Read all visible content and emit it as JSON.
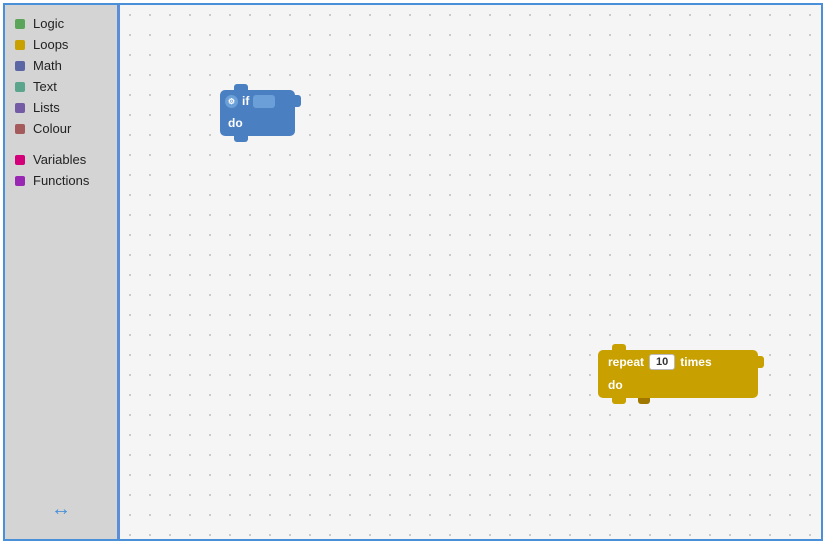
{
  "sidebar": {
    "items": [
      {
        "id": "logic",
        "label": "Logic",
        "color": "#5ba55b"
      },
      {
        "id": "loops",
        "label": "Loops",
        "color": "#c8a000"
      },
      {
        "id": "math",
        "label": "Math",
        "color": "#5b67a5"
      },
      {
        "id": "text",
        "label": "Text",
        "color": "#5ba58c"
      },
      {
        "id": "lists",
        "label": "Lists",
        "color": "#745ba5"
      },
      {
        "id": "colour",
        "label": "Colour",
        "color": "#a55b5b"
      }
    ],
    "items2": [
      {
        "id": "variables",
        "label": "Variables",
        "color": "#d4007a"
      },
      {
        "id": "functions",
        "label": "Functions",
        "color": "#9a27b4"
      }
    ]
  },
  "blocks": {
    "if_block": {
      "top_label": "if",
      "bottom_label": "do"
    },
    "repeat_block": {
      "top_label1": "repeat",
      "top_value": "10",
      "top_label2": "times",
      "bottom_label": "do"
    }
  },
  "resize_arrow": "↔"
}
